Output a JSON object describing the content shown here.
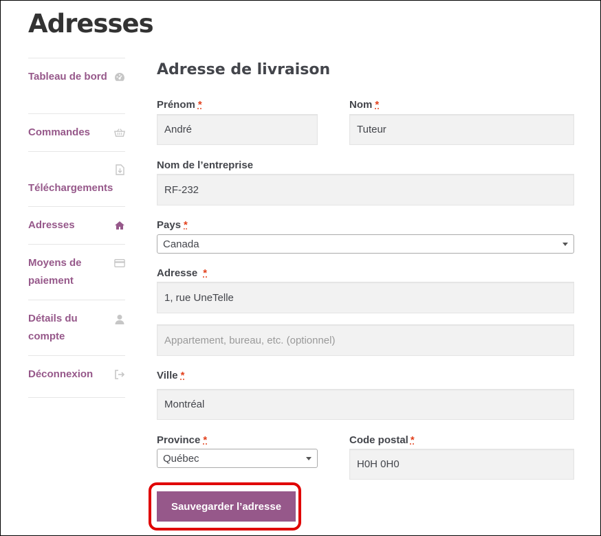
{
  "page_title": "Adresses",
  "nav": {
    "items": [
      {
        "label": "Tableau de bord",
        "icon": "dashboard-icon"
      },
      {
        "label": "Commandes",
        "icon": "basket-icon"
      },
      {
        "label": "Téléchargements",
        "icon": "file-download-icon"
      },
      {
        "label": "Adresses",
        "icon": "home-icon",
        "active": true
      },
      {
        "label": "Moyens de paiement",
        "icon": "credit-card-icon"
      },
      {
        "label": "Détails du compte",
        "icon": "user-icon"
      },
      {
        "label": "Déconnexion",
        "icon": "sign-out-icon"
      }
    ]
  },
  "form": {
    "title": "Adresse de livraison",
    "required_mark": "*",
    "prenom": {
      "label": "Prénom",
      "value": "André"
    },
    "nom": {
      "label": "Nom",
      "value": "Tuteur"
    },
    "entreprise": {
      "label": "Nom de l’entreprise",
      "value": "RF-232"
    },
    "pays": {
      "label": "Pays",
      "value": "Canada"
    },
    "adresse": {
      "label": "Adresse",
      "value": "1, rue UneTelle"
    },
    "adresse2": {
      "value": "",
      "placeholder": "Appartement, bureau, etc. (optionnel)"
    },
    "ville": {
      "label": "Ville",
      "value": "Montréal"
    },
    "province": {
      "label": "Province",
      "value": "Québec"
    },
    "code_postal": {
      "label": "Code postal",
      "value": "H0H 0H0"
    },
    "save_label": "Sauvegarder l’adresse"
  },
  "colors": {
    "accent": "#96588a",
    "highlight": "#e00000",
    "required": "#e2401c"
  }
}
